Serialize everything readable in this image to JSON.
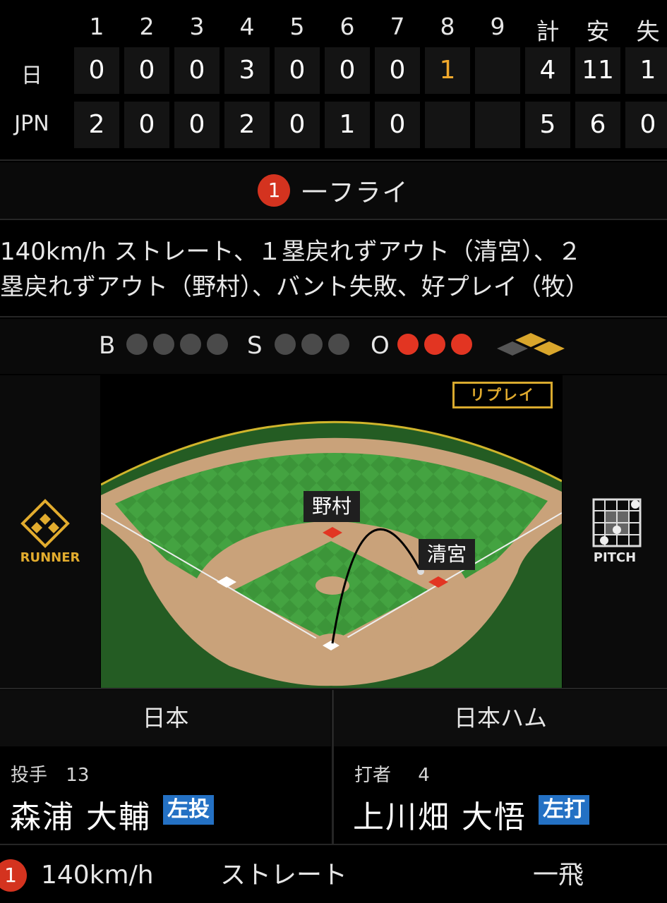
{
  "scoreboard": {
    "headers": [
      "1",
      "2",
      "3",
      "4",
      "5",
      "6",
      "7",
      "8",
      "9",
      "計",
      "安",
      "失"
    ],
    "teams": [
      {
        "name": "日",
        "innings": [
          "0",
          "0",
          "0",
          "3",
          "0",
          "0",
          "0",
          "1",
          ""
        ],
        "totals": [
          "4",
          "11",
          "1"
        ]
      },
      {
        "name": "JPN",
        "innings": [
          "2",
          "0",
          "0",
          "2",
          "0",
          "1",
          "0",
          "",
          ""
        ],
        "totals": [
          "5",
          "6",
          "0"
        ]
      }
    ],
    "highlight_color": "#f2a92c"
  },
  "play": {
    "out_number": "1",
    "result": "一フライ",
    "description_line1": "140km/h ストレート、１塁戻れずアウト（清宮）、２",
    "description_line2": "塁戻れずアウト（野村）、バント失敗、好プレイ（牧）"
  },
  "count": {
    "balls_label": "B",
    "strikes_label": "S",
    "outs_label": "O",
    "balls": 0,
    "strikes": 0,
    "outs": 3,
    "out_color": "#e23522"
  },
  "field": {
    "replay_label": "リプレイ",
    "runner_label": "RUNNER",
    "pitch_label": "PITCH",
    "fielders": [
      "野村",
      "清宮"
    ],
    "grass_color": "#3f9a3c",
    "dirt_color": "#c9a27a"
  },
  "teams": {
    "left": "日本",
    "right": "日本ハム"
  },
  "pitcher": {
    "role": "投手",
    "number": "13",
    "name": "森浦 大輔",
    "hand": "左投"
  },
  "batter": {
    "role": "打者",
    "number": "4",
    "name": "上川畑 大悟",
    "hand": "左打"
  },
  "pitch_log": {
    "index": "1",
    "speed": "140km/h",
    "type": "ストレート",
    "result": "一飛"
  },
  "icons": [
    "runner-diamond-icon",
    "pitch-zone-icon",
    "bases-icon"
  ]
}
